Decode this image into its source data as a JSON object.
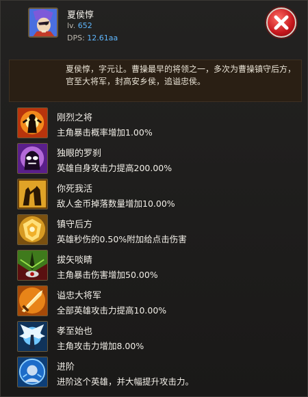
{
  "hero": {
    "name": "夏侯惇",
    "level_prefix": "lv. ",
    "level": "652",
    "dps_prefix": "DPS: ",
    "dps": "12.61aa",
    "description": "夏侯惇，字元让。曹操最早的将领之一，多次为曹操镇守后方，官至大将军，封高安乡侯，追谥忠侯。"
  },
  "close_icon": "close-x-icon",
  "skills": [
    {
      "name": "刚烈之将",
      "effect": "主角暴击概率增加1.00%",
      "icon": "flame-warrior-icon"
    },
    {
      "name": "独眼的罗刹",
      "effect": "英雄自身攻击力提高200.00%",
      "icon": "purple-demon-icon"
    },
    {
      "name": "你死我活",
      "effect": "敌人金币掉落数量增加10.00%",
      "icon": "golden-fighters-icon"
    },
    {
      "name": "镇守后方",
      "effect": "英雄秒伤的0.50%附加给点击伤害",
      "icon": "golden-shield-icon"
    },
    {
      "name": "拔矢啖睛",
      "effect": "主角暴击伤害增加50.00%",
      "icon": "green-arrow-icon"
    },
    {
      "name": "谥忠大将军",
      "effect": "全部英雄攻击力提高10.00%",
      "icon": "golden-sword-icon"
    },
    {
      "name": "孝至始也",
      "effect": "主角攻击力增加8.00%",
      "icon": "winged-light-icon"
    },
    {
      "name": "进阶",
      "effect": "进阶这个英雄，并大幅提升攻击力。",
      "icon": "advance-portrait-icon"
    }
  ]
}
